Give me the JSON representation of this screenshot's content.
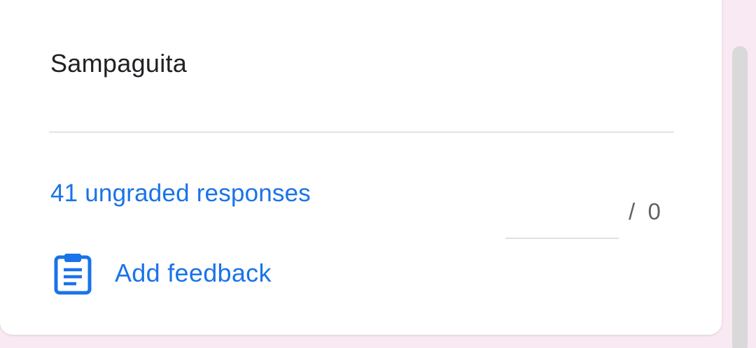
{
  "question": {
    "answer_text": "Sampaguita"
  },
  "grading": {
    "ungraded_link": "41 ungraded responses",
    "points_value": "",
    "points_total": "/  0"
  },
  "feedback": {
    "button_label": "Add feedback",
    "icon": "clipboard-icon"
  },
  "colors": {
    "accent": "#1a73e8",
    "background": "#f8e9f3",
    "card": "#ffffff"
  }
}
